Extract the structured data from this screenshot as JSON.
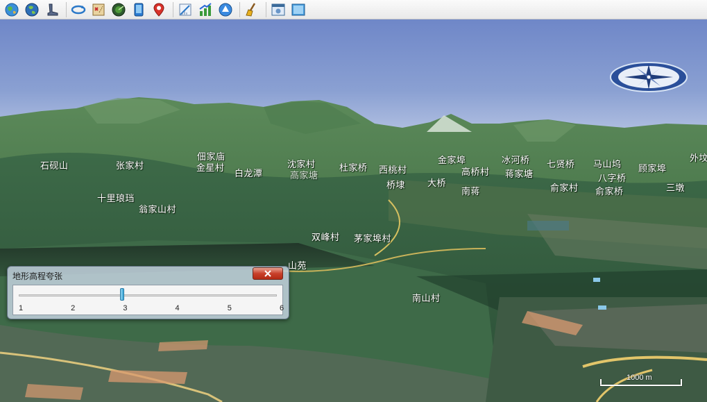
{
  "toolbar": {
    "tools": [
      {
        "icon": "globe-map-icon"
      },
      {
        "icon": "earth-icon"
      },
      {
        "icon": "walk-icon"
      },
      {
        "icon": "rotate-icon"
      },
      {
        "icon": "treasure-map-icon"
      },
      {
        "icon": "radar-globe-icon"
      },
      {
        "icon": "tablet-icon"
      },
      {
        "icon": "location-pin-icon"
      },
      {
        "icon": "measure-icon"
      },
      {
        "icon": "elevation-chart-icon"
      },
      {
        "icon": "navigate-up-icon"
      },
      {
        "icon": "broom-icon"
      },
      {
        "icon": "screenshot-window-icon"
      },
      {
        "icon": "fullscreen-window-icon"
      }
    ]
  },
  "places": [
    {
      "name": "石砚山"
    },
    {
      "name": "张家村"
    },
    {
      "name": "佃家庙"
    },
    {
      "name": "金星村"
    },
    {
      "name": "白龙潭"
    },
    {
      "name": "沈家村"
    },
    {
      "name": "高家塘"
    },
    {
      "name": "杜家桥"
    },
    {
      "name": "西桃村"
    },
    {
      "name": "金家埠"
    },
    {
      "name": "冰河桥"
    },
    {
      "name": "七贤桥"
    },
    {
      "name": "马山坞"
    },
    {
      "name": "顾家埠"
    },
    {
      "name": "外坟"
    },
    {
      "name": "高桥村"
    },
    {
      "name": "蒋家塘"
    },
    {
      "name": "八字桥"
    },
    {
      "name": "桥埭"
    },
    {
      "name": "大桥"
    },
    {
      "name": "南蒋"
    },
    {
      "name": "俞家村"
    },
    {
      "name": "俞家桥"
    },
    {
      "name": "三墩"
    },
    {
      "name": "十里琅珰"
    },
    {
      "name": "翁家山村"
    },
    {
      "name": "双峰村"
    },
    {
      "name": "茅家埠村"
    },
    {
      "name": "山苑"
    },
    {
      "name": "南山村"
    }
  ],
  "scale": {
    "label": "1000 m"
  },
  "dialog": {
    "title": "地形高程夸张",
    "slider": {
      "min": 1,
      "max": 6,
      "value": 3,
      "ticks": [
        "1",
        "2",
        "3",
        "4",
        "5",
        "6"
      ]
    }
  }
}
